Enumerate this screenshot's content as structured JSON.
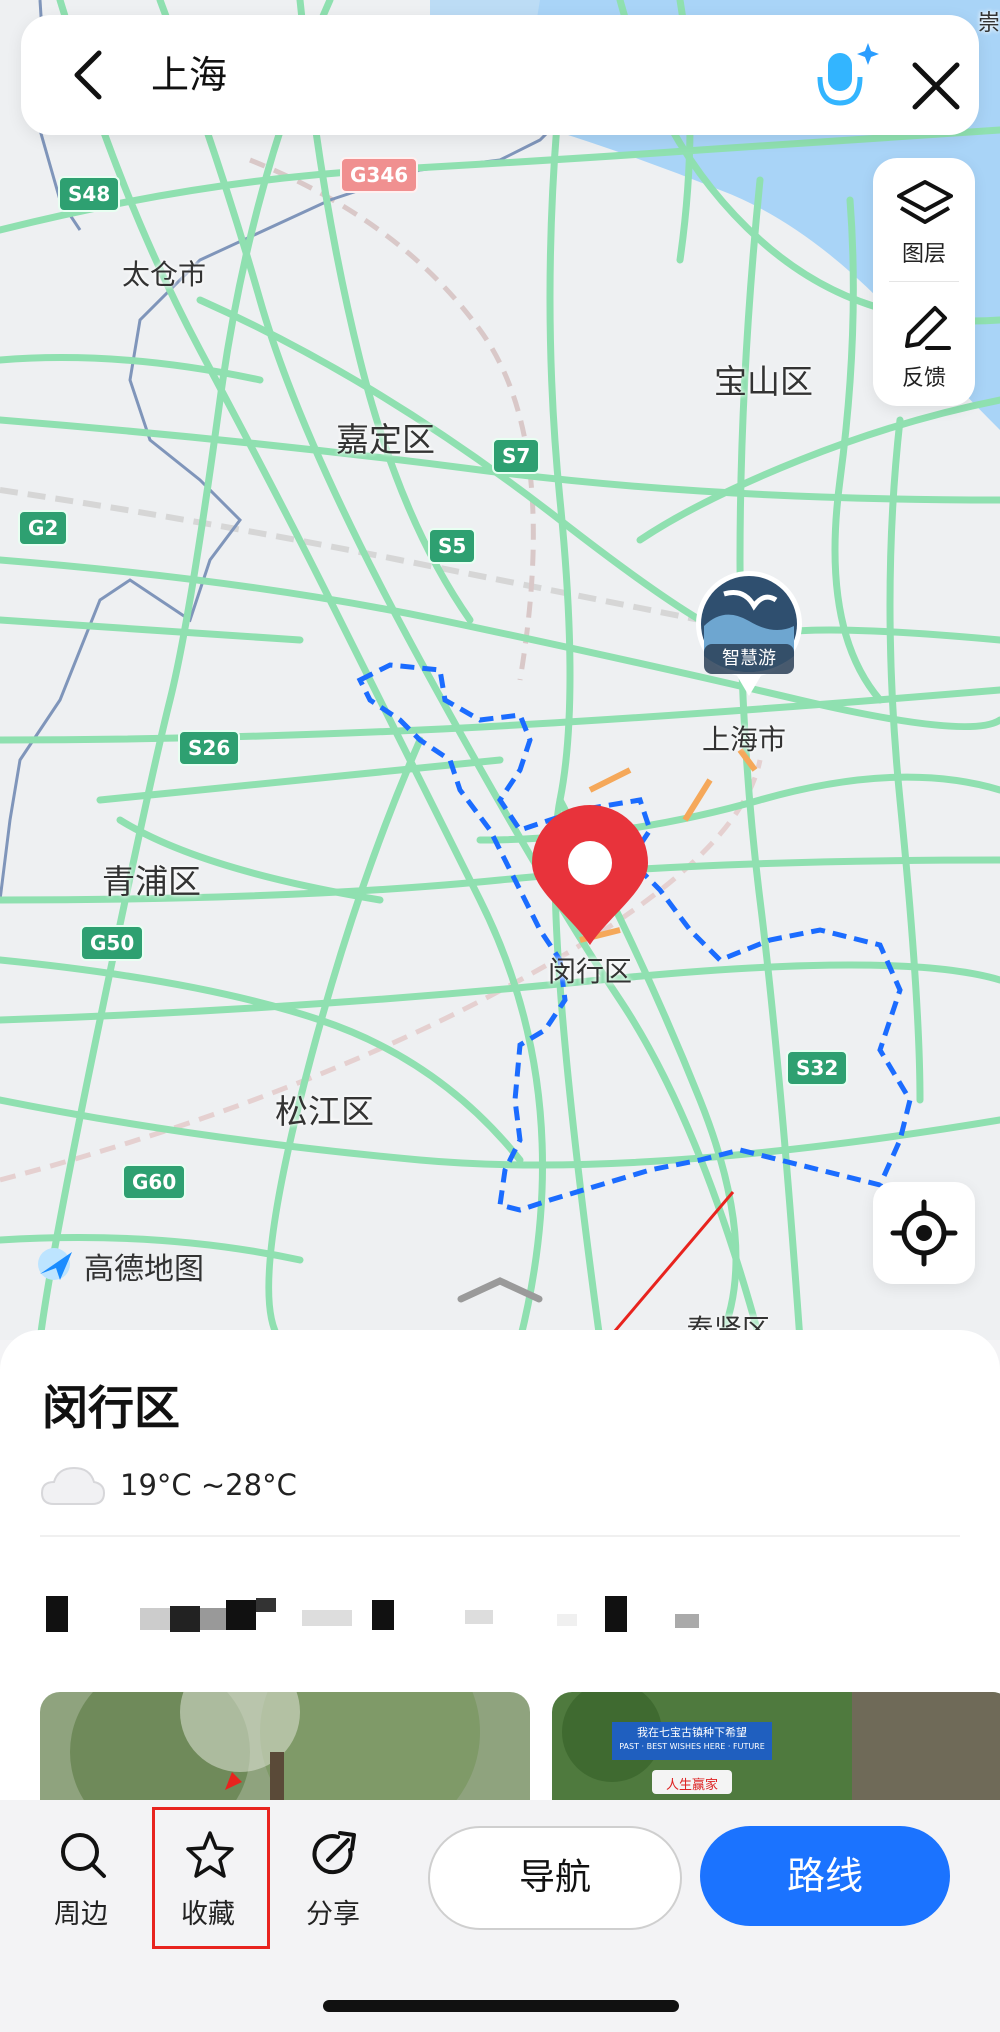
{
  "search": {
    "query": "上海"
  },
  "map_tools": {
    "layers_label": "图层",
    "feedback_label": "反馈"
  },
  "map": {
    "brand": "高德地图",
    "places": {
      "taicang": "太仓市",
      "baoshan": "宝山区",
      "jiading": "嘉定区",
      "shanghai_city": "上海市",
      "qingpu": "青浦区",
      "minhang": "闵行区",
      "songjiang": "松江区",
      "fengxian": "奉贤区",
      "chong": "崇"
    },
    "highways": {
      "s48": "S48",
      "g346": "G346",
      "s7": "S7",
      "g2": "G2",
      "s5": "S5",
      "s26": "S26",
      "g50": "G50",
      "s32": "S32",
      "g60": "G60"
    },
    "poi_badge": "智慧游",
    "route_color": "#1b6cff",
    "pin_color": "#e8333b"
  },
  "sheet": {
    "title": "闵行区",
    "weather": "19°C ~28°C",
    "photo2_sign": "我在七宝古镇种下希望",
    "photo2_sign_sub": "PAST · BEST WISHES HERE · FUTURE",
    "photo2_sign_tag": "人生赢家"
  },
  "toolbar": {
    "nearby_label": "周边",
    "favorite_label": "收藏",
    "share_label": "分享",
    "navigate_label": "导航",
    "route_label": "路线"
  },
  "annotation": {
    "color": "#e8231e"
  }
}
